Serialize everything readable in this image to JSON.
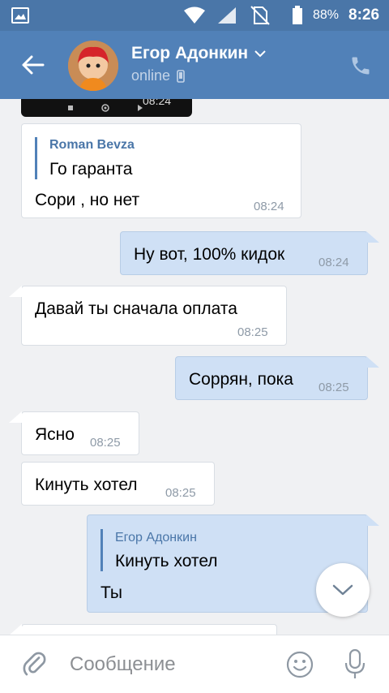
{
  "status_bar": {
    "battery": "88%",
    "time": "8:26",
    "icons": [
      "gallery-icon",
      "wifi-icon",
      "signal-icon",
      "no-sim-icon",
      "battery-icon"
    ]
  },
  "header": {
    "name": "Егор Адонкин",
    "status": "online",
    "icons": [
      "back-arrow-icon",
      "chevron-down-icon",
      "mobile-phone-icon",
      "call-icon"
    ]
  },
  "video_preview": {
    "time": "08:24"
  },
  "messages": [
    {
      "direction": "in",
      "reply_author": "Roman Bevza",
      "reply_text": "Го гаранта",
      "text": "Сори , но нет",
      "time": "08:24"
    },
    {
      "direction": "out",
      "text": "Ну вот, 100% кидок",
      "time": "08:24"
    },
    {
      "direction": "in",
      "text": "Давай ты сначала оплата",
      "time": "08:25"
    },
    {
      "direction": "out",
      "text": "Соррян, пока",
      "time": "08:25"
    },
    {
      "direction": "in",
      "text": "Ясно",
      "time": "08:25"
    },
    {
      "direction": "in",
      "text": "Кинуть хотел",
      "time": "08:25"
    },
    {
      "direction": "out",
      "reply_author": "Егор Адонкин",
      "reply_text": "Кинуть хотел",
      "text": "Ты",
      "time": ""
    }
  ],
  "composer": {
    "placeholder": "Сообщение",
    "icons": [
      "attach-icon",
      "emoji-icon",
      "microphone-icon"
    ]
  },
  "scroll_button": {
    "icon": "chevron-down-icon"
  },
  "colors": {
    "header": "#5181b8",
    "status_bar": "#4a76a8",
    "outgoing_bubble": "#cfe0f5",
    "incoming_bubble": "#ffffff",
    "background": "#f0f1f3"
  }
}
